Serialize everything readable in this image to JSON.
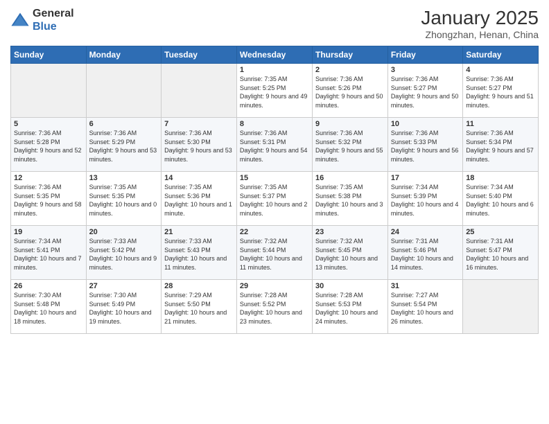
{
  "logo": {
    "line1": "General",
    "line2": "Blue"
  },
  "title": "January 2025",
  "location": "Zhongzhan, Henan, China",
  "weekdays": [
    "Sunday",
    "Monday",
    "Tuesday",
    "Wednesday",
    "Thursday",
    "Friday",
    "Saturday"
  ],
  "weeks": [
    [
      {
        "day": "",
        "empty": true
      },
      {
        "day": "",
        "empty": true
      },
      {
        "day": "",
        "empty": true
      },
      {
        "day": "1",
        "sunrise": "7:35 AM",
        "sunset": "5:25 PM",
        "daylight": "9 hours and 49 minutes."
      },
      {
        "day": "2",
        "sunrise": "7:36 AM",
        "sunset": "5:26 PM",
        "daylight": "9 hours and 50 minutes."
      },
      {
        "day": "3",
        "sunrise": "7:36 AM",
        "sunset": "5:27 PM",
        "daylight": "9 hours and 50 minutes."
      },
      {
        "day": "4",
        "sunrise": "7:36 AM",
        "sunset": "5:27 PM",
        "daylight": "9 hours and 51 minutes."
      }
    ],
    [
      {
        "day": "5",
        "sunrise": "7:36 AM",
        "sunset": "5:28 PM",
        "daylight": "9 hours and 52 minutes."
      },
      {
        "day": "6",
        "sunrise": "7:36 AM",
        "sunset": "5:29 PM",
        "daylight": "9 hours and 53 minutes."
      },
      {
        "day": "7",
        "sunrise": "7:36 AM",
        "sunset": "5:30 PM",
        "daylight": "9 hours and 53 minutes."
      },
      {
        "day": "8",
        "sunrise": "7:36 AM",
        "sunset": "5:31 PM",
        "daylight": "9 hours and 54 minutes."
      },
      {
        "day": "9",
        "sunrise": "7:36 AM",
        "sunset": "5:32 PM",
        "daylight": "9 hours and 55 minutes."
      },
      {
        "day": "10",
        "sunrise": "7:36 AM",
        "sunset": "5:33 PM",
        "daylight": "9 hours and 56 minutes."
      },
      {
        "day": "11",
        "sunrise": "7:36 AM",
        "sunset": "5:34 PM",
        "daylight": "9 hours and 57 minutes."
      }
    ],
    [
      {
        "day": "12",
        "sunrise": "7:36 AM",
        "sunset": "5:35 PM",
        "daylight": "9 hours and 58 minutes."
      },
      {
        "day": "13",
        "sunrise": "7:35 AM",
        "sunset": "5:35 PM",
        "daylight": "10 hours and 0 minutes."
      },
      {
        "day": "14",
        "sunrise": "7:35 AM",
        "sunset": "5:36 PM",
        "daylight": "10 hours and 1 minute."
      },
      {
        "day": "15",
        "sunrise": "7:35 AM",
        "sunset": "5:37 PM",
        "daylight": "10 hours and 2 minutes."
      },
      {
        "day": "16",
        "sunrise": "7:35 AM",
        "sunset": "5:38 PM",
        "daylight": "10 hours and 3 minutes."
      },
      {
        "day": "17",
        "sunrise": "7:34 AM",
        "sunset": "5:39 PM",
        "daylight": "10 hours and 4 minutes."
      },
      {
        "day": "18",
        "sunrise": "7:34 AM",
        "sunset": "5:40 PM",
        "daylight": "10 hours and 6 minutes."
      }
    ],
    [
      {
        "day": "19",
        "sunrise": "7:34 AM",
        "sunset": "5:41 PM",
        "daylight": "10 hours and 7 minutes."
      },
      {
        "day": "20",
        "sunrise": "7:33 AM",
        "sunset": "5:42 PM",
        "daylight": "10 hours and 9 minutes."
      },
      {
        "day": "21",
        "sunrise": "7:33 AM",
        "sunset": "5:43 PM",
        "daylight": "10 hours and 11 minutes."
      },
      {
        "day": "22",
        "sunrise": "7:32 AM",
        "sunset": "5:44 PM",
        "daylight": "10 hours and 11 minutes."
      },
      {
        "day": "23",
        "sunrise": "7:32 AM",
        "sunset": "5:45 PM",
        "daylight": "10 hours and 13 minutes."
      },
      {
        "day": "24",
        "sunrise": "7:31 AM",
        "sunset": "5:46 PM",
        "daylight": "10 hours and 14 minutes."
      },
      {
        "day": "25",
        "sunrise": "7:31 AM",
        "sunset": "5:47 PM",
        "daylight": "10 hours and 16 minutes."
      }
    ],
    [
      {
        "day": "26",
        "sunrise": "7:30 AM",
        "sunset": "5:48 PM",
        "daylight": "10 hours and 18 minutes."
      },
      {
        "day": "27",
        "sunrise": "7:30 AM",
        "sunset": "5:49 PM",
        "daylight": "10 hours and 19 minutes."
      },
      {
        "day": "28",
        "sunrise": "7:29 AM",
        "sunset": "5:50 PM",
        "daylight": "10 hours and 21 minutes."
      },
      {
        "day": "29",
        "sunrise": "7:28 AM",
        "sunset": "5:52 PM",
        "daylight": "10 hours and 23 minutes."
      },
      {
        "day": "30",
        "sunrise": "7:28 AM",
        "sunset": "5:53 PM",
        "daylight": "10 hours and 24 minutes."
      },
      {
        "day": "31",
        "sunrise": "7:27 AM",
        "sunset": "5:54 PM",
        "daylight": "10 hours and 26 minutes."
      },
      {
        "day": "",
        "empty": true
      }
    ]
  ]
}
